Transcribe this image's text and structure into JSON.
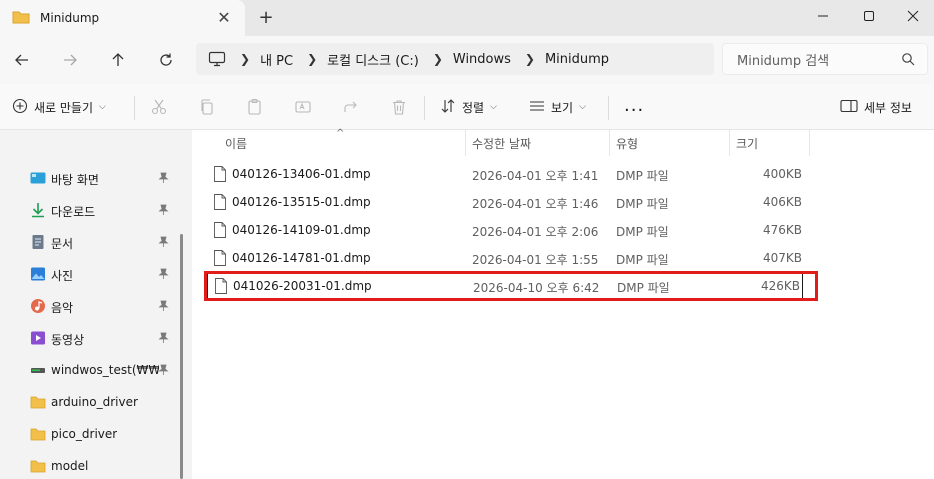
{
  "colors": {
    "accent": "#0067c0",
    "highlight": "#e21b1b",
    "folder": "#f2c04a"
  },
  "tab": {
    "title": "Minidump",
    "icon": "folder-icon"
  },
  "address": {
    "pc_icon": "computer-icon",
    "crumbs": [
      "내 PC",
      "로컬 디스크 (C:)",
      "Windows",
      "Minidump"
    ]
  },
  "search": {
    "placeholder": "Minidump 검색"
  },
  "toolbar": {
    "new_label": "새로 만들기",
    "sort_label": "정렬",
    "view_label": "보기",
    "more_label": "...",
    "details_label": "세부 정보"
  },
  "sidebar": {
    "items": [
      {
        "label": "바탕 화면",
        "icon": "desktop-icon",
        "pinned": true
      },
      {
        "label": "다운로드",
        "icon": "download-icon",
        "pinned": true
      },
      {
        "label": "문서",
        "icon": "document-icon",
        "pinned": true
      },
      {
        "label": "사진",
        "icon": "picture-icon",
        "pinned": true
      },
      {
        "label": "음악",
        "icon": "music-icon",
        "pinned": true
      },
      {
        "label": "동영상",
        "icon": "video-icon",
        "pinned": true
      },
      {
        "label": "windwos_test(₩₩VE",
        "icon": "network-drive-icon",
        "pinned": true
      },
      {
        "label": "arduino_driver",
        "icon": "folder-icon",
        "pinned": false
      },
      {
        "label": "pico_driver",
        "icon": "folder-icon",
        "pinned": false
      },
      {
        "label": "model",
        "icon": "folder-icon",
        "pinned": false
      }
    ]
  },
  "table": {
    "headers": {
      "name": "이름",
      "date": "수정한 날짜",
      "type": "유형",
      "size": "크기"
    },
    "rows": [
      {
        "name": "040126-13406-01.dmp",
        "date": "2026-04-01 오후 1:41",
        "type": "DMP 파일",
        "size": "400KB"
      },
      {
        "name": "040126-13515-01.dmp",
        "date": "2026-04-01 오후 1:46",
        "type": "DMP 파일",
        "size": "406KB"
      },
      {
        "name": "040126-14109-01.dmp",
        "date": "2026-04-01 오후 2:06",
        "type": "DMP 파일",
        "size": "476KB"
      },
      {
        "name": "040126-14781-01.dmp",
        "date": "2026-04-01 오후 1:55",
        "type": "DMP 파일",
        "size": "407KB"
      },
      {
        "name": "041026-20031-01.dmp",
        "date": "2026-04-10 오후 6:42",
        "type": "DMP 파일",
        "size": "426KB",
        "selected": true
      }
    ]
  }
}
